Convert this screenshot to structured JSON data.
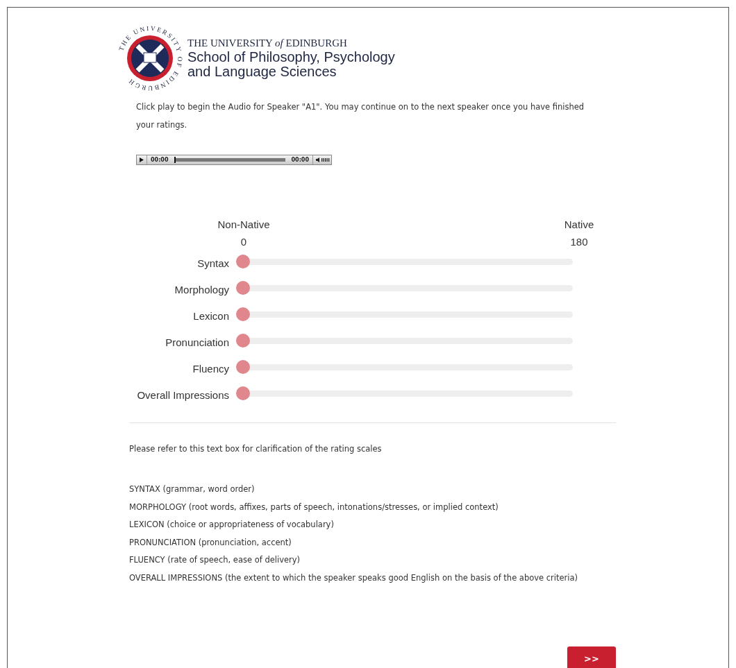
{
  "header": {
    "seal_text": "THE UNIVERSITY OF EDINBURGH",
    "university": "THE UNIVERSITY *of* EDINBURGH",
    "school_lines": [
      "School of Philosophy, Psychology",
      "and Language Sciences"
    ]
  },
  "instructions": "Click play to begin the Audio for Speaker \"A1\". You may continue on to the next speaker once you have finished your ratings.",
  "audio_player": {
    "current_time": "00:00",
    "duration": "00:00",
    "level": 0
  },
  "scale": {
    "min_label": "Non-Native",
    "max_label": "Native",
    "min_value": "0",
    "max_value": "180"
  },
  "sliders": [
    {
      "label": "Syntax",
      "level": 0
    },
    {
      "label": "Morphology",
      "level": 0
    },
    {
      "label": "Lexicon",
      "level": 0
    },
    {
      "label": "Pronunciation",
      "level": 0
    },
    {
      "label": "Fluency",
      "level": 0
    },
    {
      "label": "Overall Impressions",
      "level": 0
    }
  ],
  "clarification": {
    "intro": "Please refer to this text box for clarification of the rating scales",
    "definitions": [
      "SYNTAX (grammar, word order)",
      "MORPHOLOGY (root words, affixes, parts of speech, intonations/stresses, or implied context)",
      "LEXICON (choice or appropriateness of vocabulary)",
      "PRONUNCIATION (pronunciation, accent)",
      "FLUENCY (rate of speech, ease of delivery)",
      "OVERALL IMPRESSIONS (the extent to which the speaker speaks good English on the basis of the above criteria)"
    ]
  },
  "next_button": {
    "label": ">>"
  }
}
